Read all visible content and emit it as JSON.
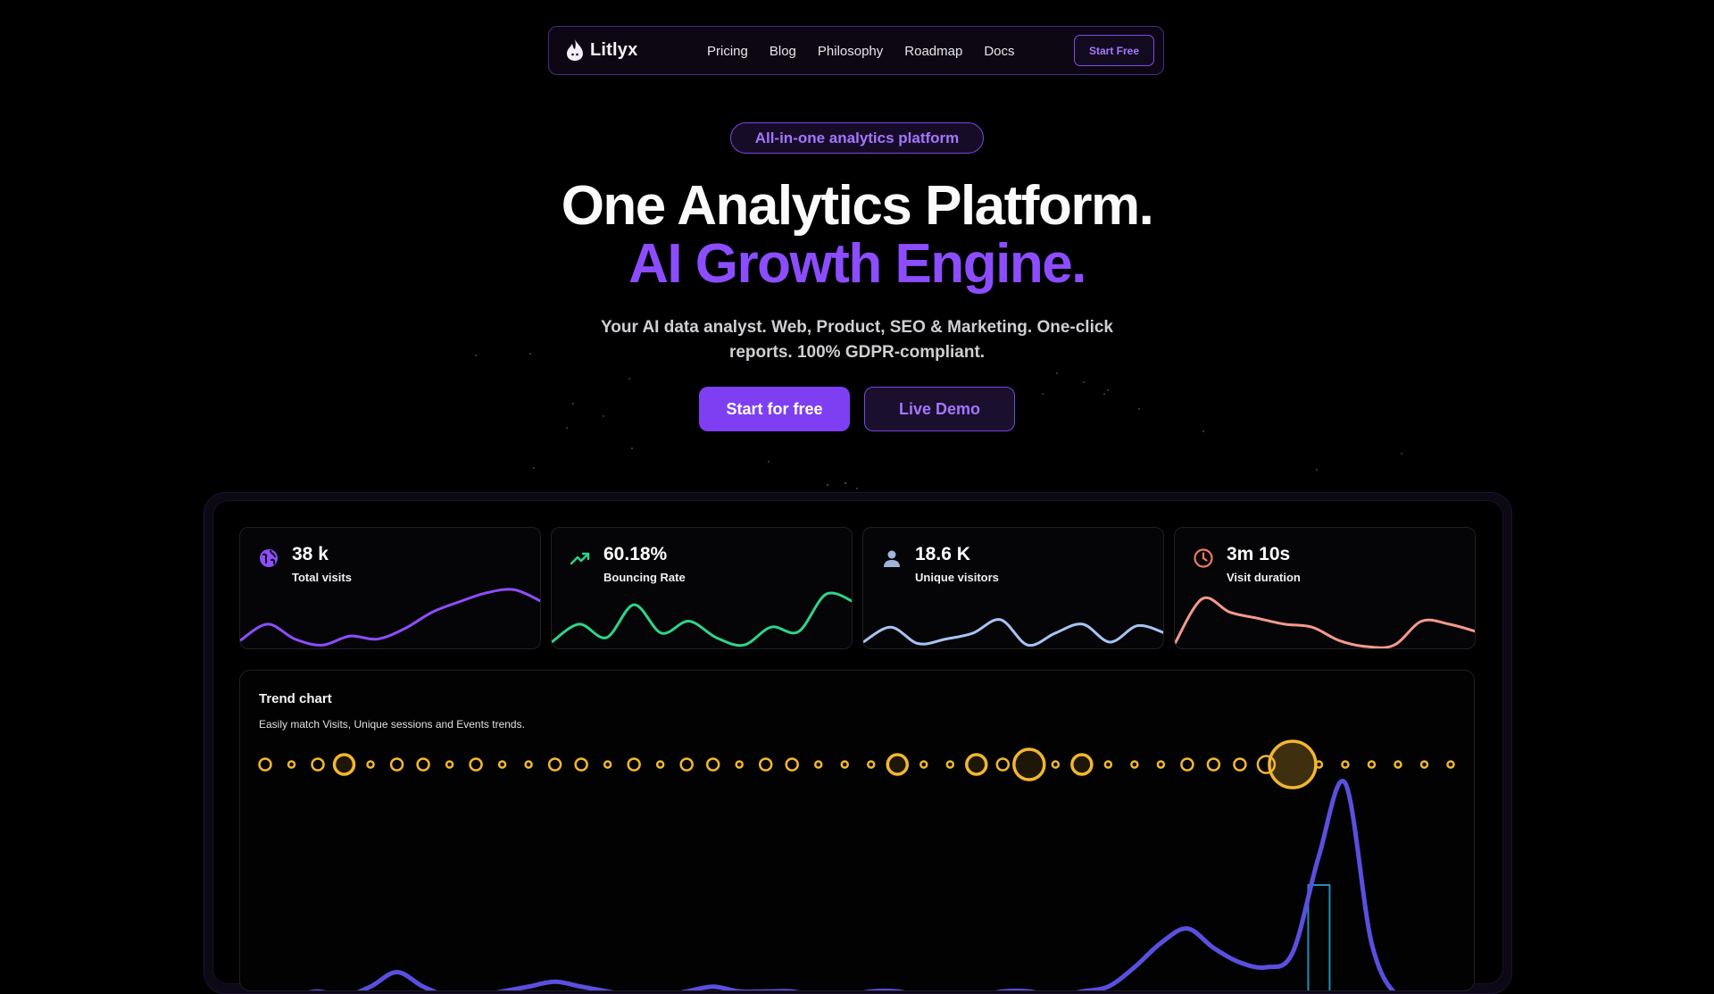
{
  "nav": {
    "logo_text": "Litlyx",
    "links": [
      "Pricing",
      "Blog",
      "Philosophy",
      "Roadmap",
      "Docs"
    ],
    "cta_label": "Start Free"
  },
  "hero": {
    "pill": "All-in-one analytics platform",
    "headline_line1": "One Analytics Platform.",
    "headline_line2": "AI Growth Engine.",
    "subtitle": "Your AI data analyst. Web, Product, SEO & Marketing. One-click reports. 100% GDPR-compliant.",
    "primary_cta": "Start for free",
    "secondary_cta": "Live Demo"
  },
  "stats": [
    {
      "value": "38 k",
      "label": "Total visits",
      "icon": "globe-icon",
      "color": "#8f4dff",
      "spark": [
        8,
        30,
        10,
        2,
        14,
        10,
        24,
        46,
        60,
        72,
        76,
        60
      ]
    },
    {
      "value": "60.18%",
      "label": "Bouncing Rate",
      "icon": "trending-up-icon",
      "color": "#2ed48a",
      "spark": [
        6,
        30,
        12,
        56,
        18,
        34,
        12,
        2,
        26,
        20,
        70,
        60
      ]
    },
    {
      "value": "18.6 K",
      "label": "Unique visitors",
      "icon": "user-icon",
      "color": "#a7c4f2",
      "spark": [
        6,
        26,
        4,
        10,
        18,
        36,
        2,
        18,
        30,
        6,
        28,
        18
      ]
    },
    {
      "value": "3m 10s",
      "label": "Visit duration",
      "icon": "clock-icon",
      "color": "#f59a8c",
      "spark": [
        4,
        64,
        46,
        38,
        30,
        26,
        8,
        0,
        2,
        34,
        30,
        20
      ]
    }
  ],
  "trend": {
    "title": "Trend chart",
    "subtitle": "Easily match Visits, Unique sessions and Events trends."
  },
  "colors": {
    "accent": "#7e3ff2",
    "accent_light": "#a575ff",
    "events_dot": "#f2b631",
    "visits_line": "#5b4fe0",
    "sessions_bar": "#1f8fb8"
  },
  "chart_data": {
    "type": "line",
    "title": "Trend chart",
    "x_count": 46,
    "series": [
      {
        "name": "Events",
        "values": [
          2,
          1,
          2,
          4,
          1,
          2,
          2,
          1,
          2,
          1,
          1,
          2,
          2,
          1,
          2,
          1,
          2,
          2,
          1,
          2,
          2,
          1,
          1,
          1,
          4,
          1,
          1,
          5,
          2,
          8,
          1,
          4,
          1,
          1,
          1,
          2,
          2,
          2,
          3,
          15,
          1,
          1,
          1,
          1,
          1,
          1
        ]
      },
      {
        "name": "Visits",
        "values": [
          1,
          1,
          2,
          1,
          3,
          6,
          3,
          1,
          1,
          2,
          3,
          4,
          3,
          2,
          1,
          1,
          2,
          3,
          2,
          2,
          2,
          1,
          1,
          2,
          2,
          1,
          1,
          1,
          2,
          2,
          1,
          2,
          3,
          7,
          12,
          15,
          11,
          8,
          7,
          10,
          30,
          45,
          12,
          1,
          1,
          1
        ]
      },
      {
        "name": "Unique sessions",
        "values": [
          0,
          0,
          0,
          0,
          0,
          0,
          0,
          0,
          0,
          0,
          0,
          0,
          0,
          0,
          0,
          0,
          0,
          0,
          0,
          0,
          0,
          0,
          0,
          0,
          0,
          0,
          0,
          0,
          0,
          0,
          0,
          0,
          0,
          0,
          0,
          0,
          0,
          0,
          0,
          0,
          22,
          0,
          0,
          0,
          0,
          0
        ]
      }
    ]
  }
}
